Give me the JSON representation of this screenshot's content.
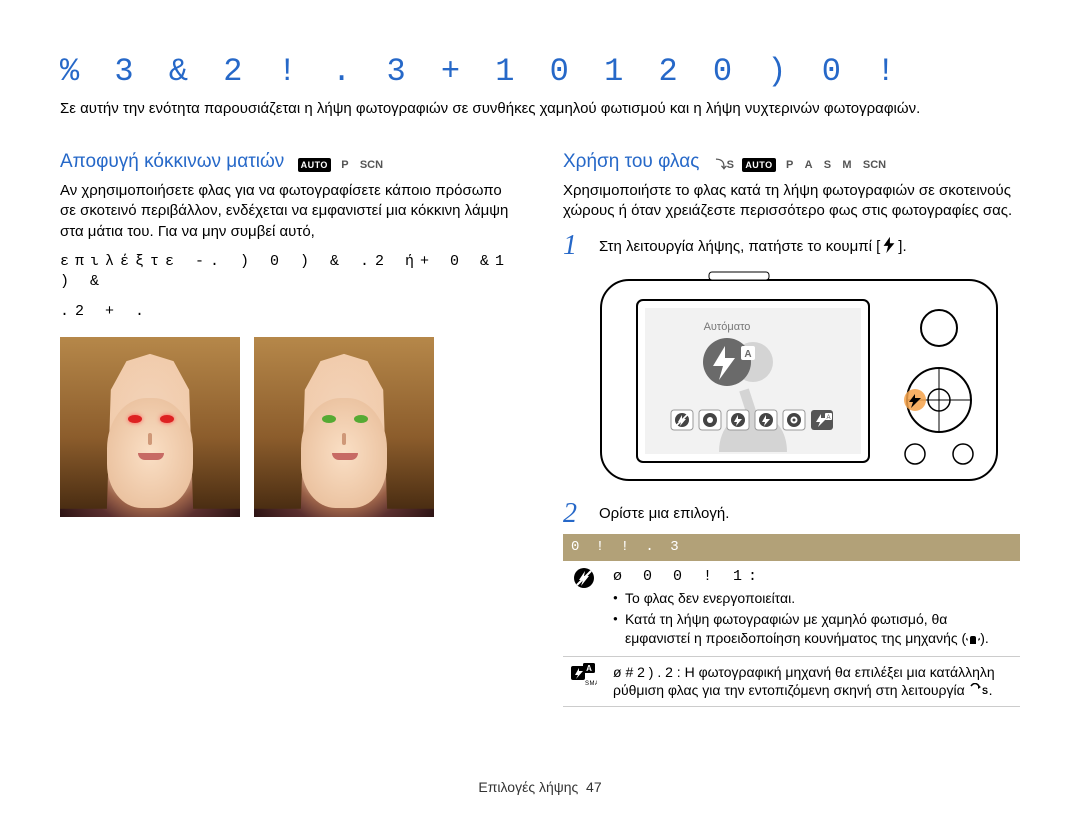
{
  "title_glyphs": "%  3 & 2   ! . 3  +   1 0  1   2 0   )   0 !",
  "intro": "Σε αυτήν την ενότητα παρουσιάζεται η λήψη φωτογραφιών σε συνθήκες χαμηλού φωτισμού και η λήψη νυχτερινών φωτογραφιών.",
  "left": {
    "heading": "Αποφυγή κόκκινων ματιών",
    "modes_badges": [
      "AUTO"
    ],
    "modes_plain": [
      "P",
      "SCN"
    ],
    "para": "Αν χρησιμοποιήσετε φλας για να φωτογραφίσετε κάποιο πρόσωπο σε σκοτεινό περιβάλλον, ενδέχεται να εμφανιστεί μια κόκκινη λάμψη στα μάτια του. Για να μην συμβεί αυτό,",
    "glyphline1": "επιλέξτε -.  )  0     )     &   .2 ή+  0 &1   )   &",
    "glyphline2": ".2  +  ."
  },
  "right": {
    "heading": "Χρήση του φλας",
    "modes_badges": [
      "AUTO"
    ],
    "modes_plain_pre": [
      "⤵S"
    ],
    "modes_plain": [
      "P",
      "A",
      "S",
      "M",
      "SCN"
    ],
    "para": "Χρησιμοποιήστε το φλας κατά τη λήψη φωτογραφιών σε σκοτεινούς χώρους ή όταν χρειάζεστε περισσότερο φως στις φωτογραφίες σας.",
    "step1": "Στη λειτουργία λήψης, πατήστε το κουμπί [",
    "step1_end": "].",
    "camera_label": "Αυτόματο",
    "step2": "Ορίστε μια επιλογή.",
    "table_header": "0 !   ! . 3",
    "row_off_title": "ø   0   0 !         1:",
    "row_off_b1": "Το φλας δεν ενεργοποιείται.",
    "row_off_b2": "Κατά τη λήψη φωτογραφιών με χαμηλό φωτισμό, θα εμφανιστεί η προειδοποίηση κουνήματος της μηχανής (",
    "row_off_b2_end": ").",
    "row_auto": "ø # 2 )  . 2 : Η φωτογραφική μηχανή θα επιλέξει μια κατάλληλη ρύθμιση φλας για την εντοπιζόμενη σκηνή στη λειτουργία ",
    "row_auto_end": "."
  },
  "footer_label": "Επιλογές λήψης",
  "footer_page": "47",
  "chart_data": null
}
